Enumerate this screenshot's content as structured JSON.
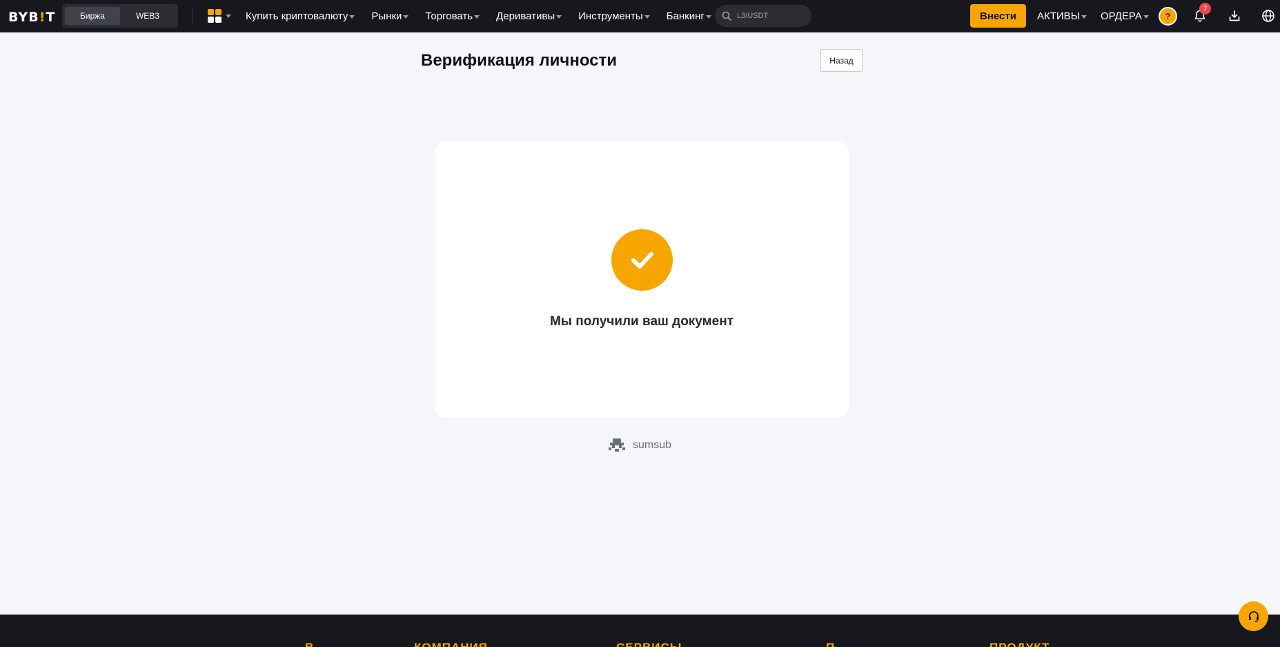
{
  "header": {
    "logo": {
      "prefix": "BYB",
      "accent": "!",
      "suffix": "T"
    },
    "segment": [
      "Биржа",
      "WEB3"
    ],
    "nav": [
      "Купить криптовалюту",
      "Рынки",
      "Торговать",
      "Деривативы",
      "Инструменты",
      "Банкинг"
    ],
    "search_placeholder": "L3/USDT",
    "deposit_label": "Внести",
    "assets_label": "АКТИВЫ",
    "orders_label": "ОРДЕРА",
    "avatar_text": "?",
    "notification_count": "7"
  },
  "main": {
    "title": "Верификация личности",
    "back_label": "Назад",
    "card": {
      "message": "Мы получили ваш документ"
    },
    "powered_by": "sumsub"
  },
  "footer": {
    "headings": [
      "В",
      "КОМПАНИЯ",
      "СЕРВИСЫ",
      "П",
      "ПРОДУКТ"
    ]
  },
  "colors": {
    "accent": "#f7a600",
    "topbar_bg": "#17181e",
    "page_bg": "#f5f6fa",
    "badge": "#ef454a"
  },
  "icons": [
    "apps-grid-icon",
    "search-icon",
    "bell-icon",
    "download-icon",
    "globe-icon",
    "check-icon",
    "headset-icon",
    "sumsub-logo-icon"
  ]
}
